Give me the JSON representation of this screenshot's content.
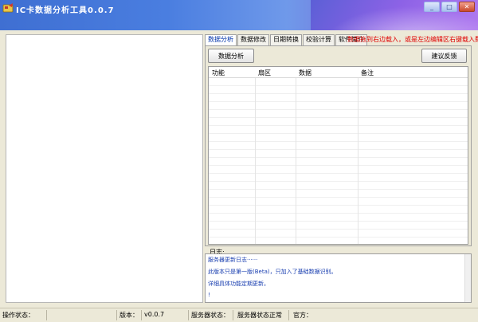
{
  "window": {
    "title": "IC卡数据分析工具0.0.7",
    "minimize_glyph": "_",
    "maximize_glyph": "□",
    "close_glyph": "✕"
  },
  "tabs": [
    {
      "label": "数据分析",
      "active": true
    },
    {
      "label": "数据修改",
      "active": false
    },
    {
      "label": "日期转换",
      "active": false
    },
    {
      "label": "校验计算",
      "active": false
    },
    {
      "label": "软件简介",
      "active": false
    }
  ],
  "hint": "数据拖到右边载入，或是左边编辑区右键载入数据",
  "buttons": {
    "analyze": "数据分析",
    "feedback": "建议反馈"
  },
  "grid": {
    "columns": [
      "功能",
      "扇区",
      "数据",
      "备注"
    ]
  },
  "log": {
    "label": "日志:",
    "lines": [
      "服务器更新日志······",
      "此版本只是第一版(Beta)，只加入了基础数据识别。",
      "详细具体功能定期更新。",
      "!"
    ]
  },
  "status": {
    "op_label": "操作状态：",
    "op_value": "",
    "version_label": "版本：",
    "version_value": "v0.0.7",
    "server_label": "服务器状态：",
    "server_value": "服务器状态正常",
    "official_label": "官方："
  },
  "colors": {
    "title_gradient_start": "#3f6fd2",
    "hint_red": "#e00000",
    "log_blue": "#1a3fb0"
  },
  "icons": {
    "app": "app-card-icon"
  }
}
